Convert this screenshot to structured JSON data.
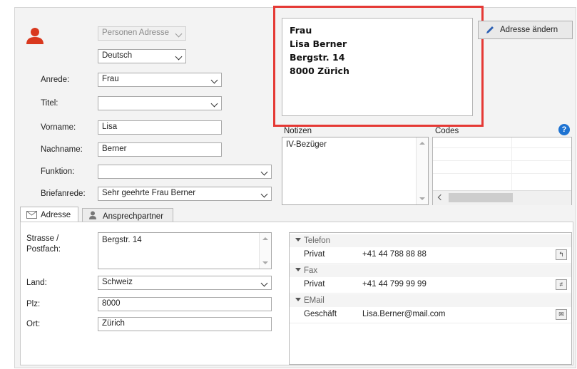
{
  "header": {
    "category_select": "Personen Adresse",
    "language_select": "Deutsch"
  },
  "form": {
    "anrede": {
      "label": "Anrede:",
      "value": "Frau"
    },
    "titel": {
      "label": "Titel:",
      "value": ""
    },
    "vorname": {
      "label": "Vorname:",
      "value": "Lisa"
    },
    "nachname": {
      "label": "Nachname:",
      "value": "Berner"
    },
    "funktion": {
      "label": "Funktion:",
      "value": ""
    },
    "briefanrede": {
      "label": "Briefanrede:",
      "value": "Sehr geehrte Frau Berner"
    }
  },
  "address_preview": {
    "line1": "Frau",
    "line2": "Lisa Berner",
    "line3": "Bergstr. 14",
    "line4": "8000 Zürich"
  },
  "address_change_button": "Adresse ändern",
  "notes": {
    "label": "Notizen",
    "value": "IV-Bezüger"
  },
  "codes": {
    "label": "Codes",
    "help": "?"
  },
  "tabs": [
    {
      "label": "Adresse"
    },
    {
      "label": "Ansprechpartner"
    }
  ],
  "address": {
    "strasse": {
      "label": "Strasse /\nPostfach:",
      "value": "Bergstr. 14"
    },
    "land": {
      "label": "Land:",
      "value": "Schweiz"
    },
    "plz": {
      "label": "Plz:",
      "value": "8000"
    },
    "ort": {
      "label": "Ort:",
      "value": "Zürich"
    }
  },
  "contacts": {
    "telefon": {
      "group": "Telefon",
      "type": "Privat",
      "value": "+41 44 788 88 88"
    },
    "fax": {
      "group": "Fax",
      "type": "Privat",
      "value": "+41 44 799 99 99"
    },
    "email": {
      "group": "EMail",
      "type": "Geschäft",
      "value": "Lisa.Berner@mail.com"
    }
  },
  "colors": {
    "highlight": "#e53935",
    "person_icon": "#d9381e",
    "help": "#1e73d2"
  }
}
